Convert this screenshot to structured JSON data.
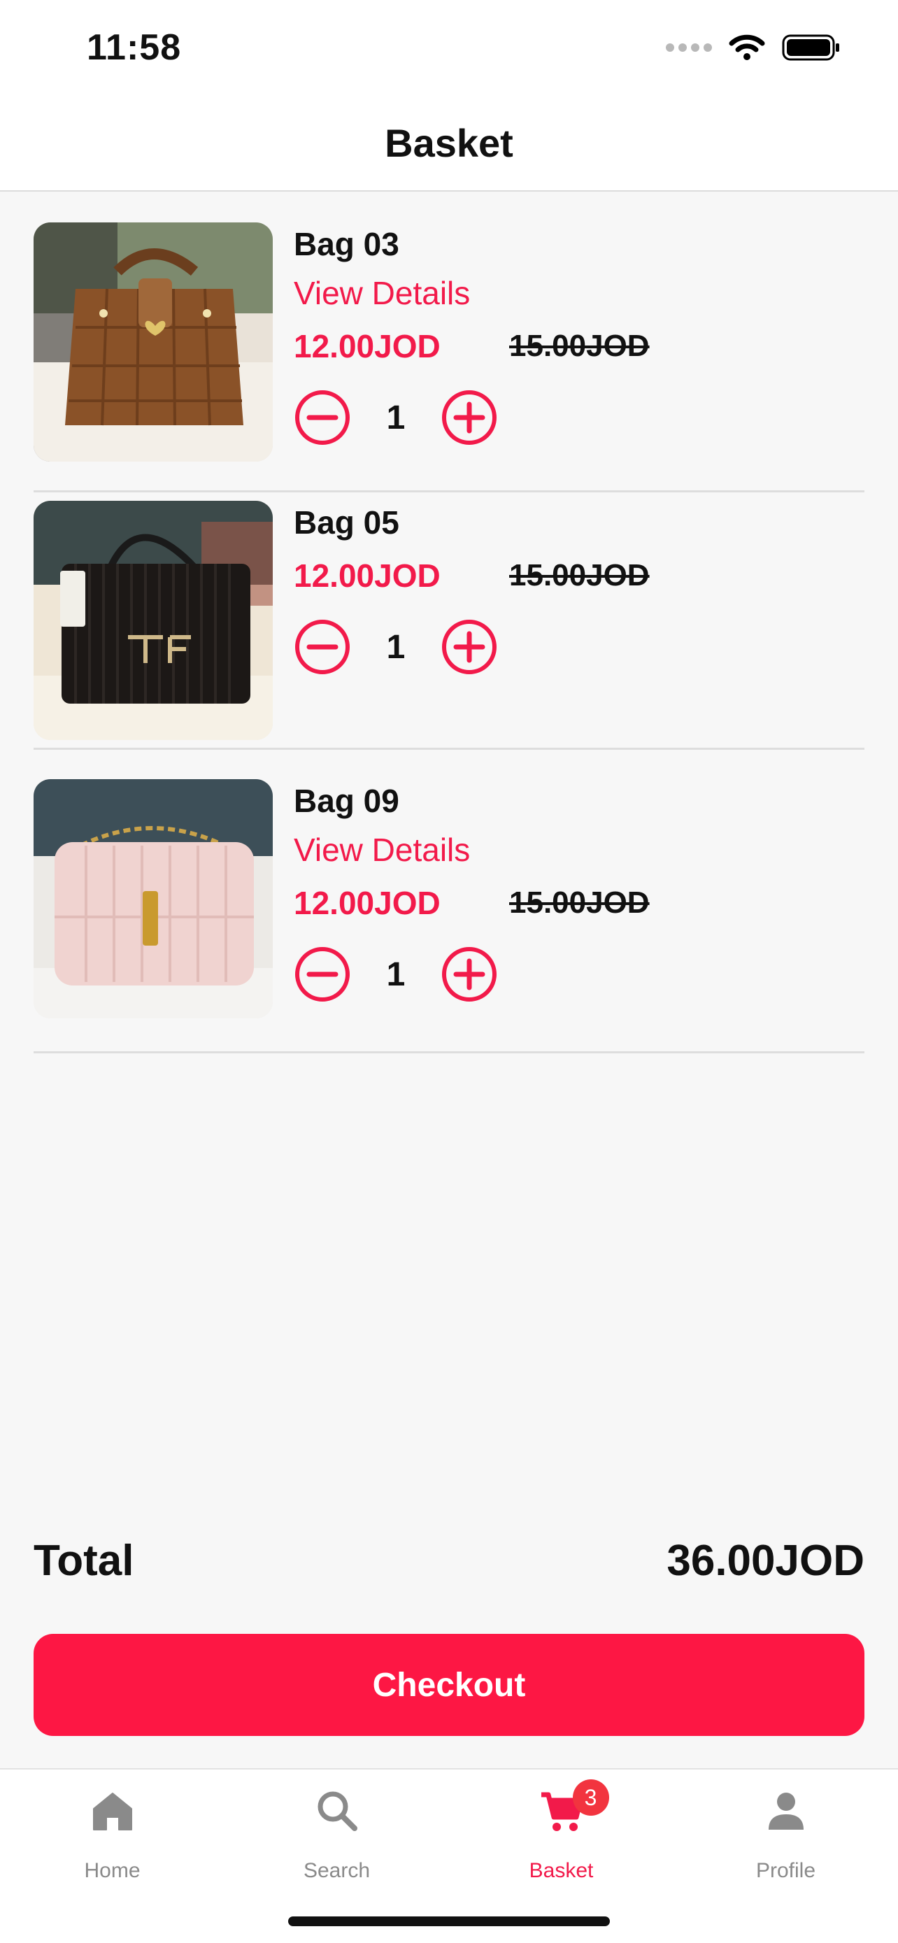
{
  "status_bar": {
    "time": "11:58"
  },
  "header": {
    "title": "Basket"
  },
  "basket": {
    "items": [
      {
        "name": "Bag 03",
        "link": "View Details",
        "price": "12.00JOD",
        "old_price": "15.00JOD",
        "quantity": "1",
        "image": "brown-quilted-handbag"
      },
      {
        "name": "Bag 05",
        "price": "12.00JOD",
        "old_price": "15.00JOD",
        "quantity": "1",
        "image": "black-ribbed-handbag-tf"
      },
      {
        "name": "Bag 09",
        "link": "View Details",
        "price": "12.00JOD",
        "old_price": "15.00JOD",
        "quantity": "1",
        "image": "pink-quilted-chain-bag"
      }
    ]
  },
  "summary": {
    "total_label": "Total",
    "total_value": "36.00JOD"
  },
  "checkout": {
    "label": "Checkout"
  },
  "tabbar": {
    "tabs": [
      {
        "label": "Home",
        "icon": "home-icon"
      },
      {
        "label": "Search",
        "icon": "search-icon"
      },
      {
        "label": "Basket",
        "icon": "cart-icon",
        "badge": "3",
        "active": true
      },
      {
        "label": "Profile",
        "icon": "person-icon"
      }
    ]
  },
  "colors": {
    "accent": "#f21a4a",
    "checkout_button": "#fd1744",
    "badge": "#f2343f",
    "inactive_tab": "#8a8a8a",
    "background": "#f7f7f7"
  }
}
